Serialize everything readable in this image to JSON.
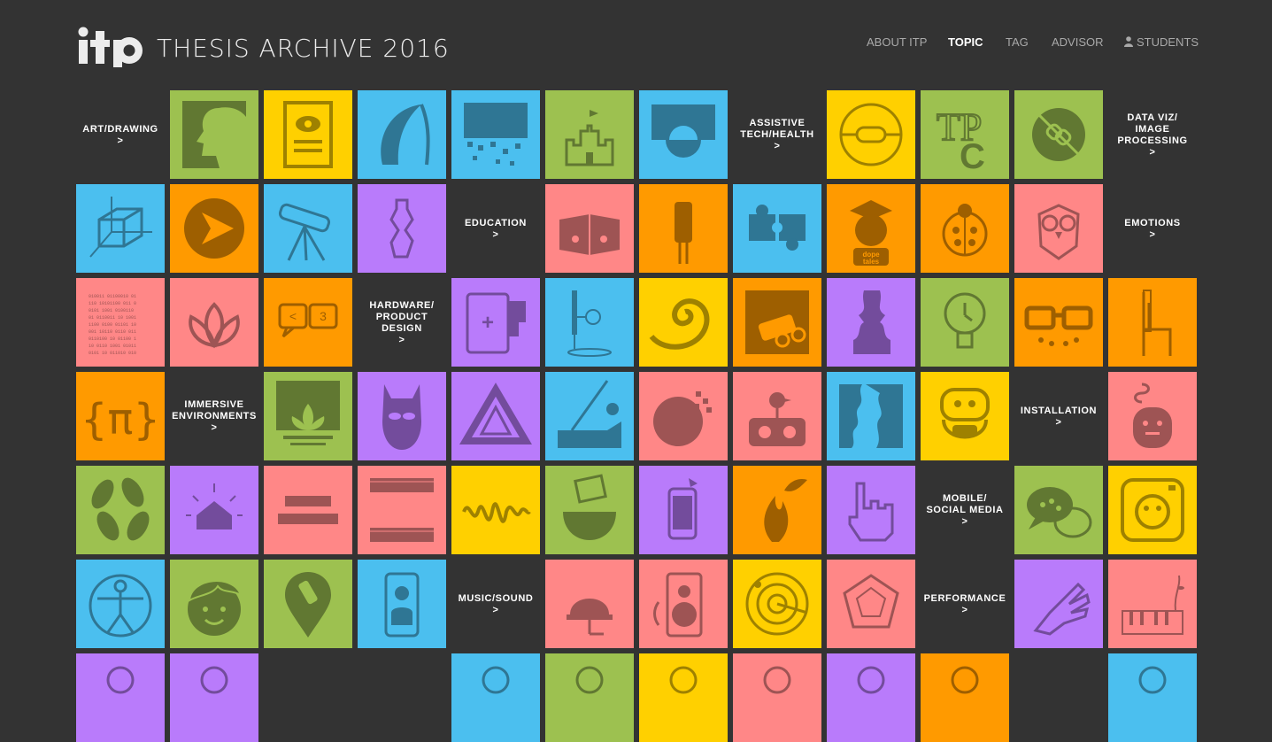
{
  "header": {
    "logo": "itp",
    "site_title": "THESIS ARCHIVE 2016"
  },
  "nav": {
    "items": [
      "ABOUT ITP",
      "TOPIC",
      "TAG",
      "ADVISOR",
      "STUDENTS"
    ],
    "active": "TOPIC",
    "students_icon": "person-icon"
  },
  "colors": {
    "background": "#333333",
    "green": "#9dc150",
    "yellow": "#ffd000",
    "blue": "#4bbfef",
    "orange": "#ff9a00",
    "pink": "#ff8787",
    "purple": "#b97bfb"
  },
  "topics": {
    "art_drawing": "ART/DRAWING",
    "assistive": "ASSISTIVE\nTECH/HEALTH",
    "data_viz": "DATA VIZ/\nIMAGE\nPROCESSING",
    "education": "EDUCATION",
    "emotions": "EMOTIONS",
    "hardware": "HARDWARE/\nPRODUCT\nDESIGN",
    "immersive": "IMMERSIVE\nENVIRONMENTS",
    "installation": "INSTALLATION",
    "mobile": "MOBILE/\nSOCIAL MEDIA",
    "music": "MUSIC/SOUND",
    "performance": "PERFORMANCE",
    "arrow": ">"
  },
  "tile_text": {
    "dope_tales": "dope\ntales",
    "heart_emoticon": "<3"
  },
  "rows": [
    [
      "label:art_drawing",
      "green:portrait-icon",
      "yellow:eye-document-icon",
      "blue:hair-strand-icon",
      "blue:pixel-waterfall-icon",
      "green:sandcastle-icon",
      "blue:circle-under-square-icon",
      "label:assistive",
      "yellow:hearing-aid-icon",
      "green:tpc-letters-icon",
      "green:broken-chain-icon",
      "label:data_viz"
    ],
    [
      "blue:3d-cube-icon",
      "orange:play-triangle-icon",
      "blue:telescope-icon",
      "purple:crumpled-bottle-icon",
      "label:education",
      "pink:open-book-icon",
      "orange:cable-plug-icon",
      "blue:puzzle-pieces-icon",
      "orange:graduate-girl-icon",
      "orange:ladybug-icon",
      "pink:owl-icon",
      "label:emotions"
    ],
    [
      "pink:binary-code-icon",
      "pink:lotus-flower-icon",
      "orange:speech-bubbles-icon",
      "label:hardware",
      "purple:battery-charger-icon",
      "blue:microphone-stand-icon",
      "yellow:nautilus-shell-icon",
      "orange:toy-car-icon",
      "purple:face-profiles-icon",
      "green:lightbulb-icon",
      "orange:glasses-monster-icon",
      "orange:chair-icon"
    ],
    [
      "orange:pi-braces-icon",
      "label:immersive",
      "green:lotus-screen-icon",
      "purple:superhero-mask-icon",
      "purple:impossible-triangle-icon",
      "blue:piano-lid-icon",
      "pink:pixel-planet-icon",
      "pink:vr-headset-bird-icon",
      "blue:map-silhouette-icon",
      "yellow:helmet-face-icon",
      "label:installation",
      "pink:robot-phone-icon"
    ],
    [
      "green:leaves-icon",
      "purple:glowing-house-icon",
      "pink:stacked-bars-icon",
      "pink:scribble-bars-icon",
      "yellow:soundwave-icon",
      "green:bowl-picture-icon",
      "purple:smartphone-bird-icon",
      "orange:flame-leaves-icon",
      "purple:pixel-hand-icon",
      "label:mobile",
      "green:chat-bubbles-icon",
      "yellow:camera-face-icon"
    ],
    [
      "blue:vitruvian-man-icon",
      "green:smiling-boy-icon",
      "green:map-pin-bottle-icon",
      "blue:phone-person-icon",
      "label:music",
      "pink:alarm-bell-icon",
      "pink:speaker-icon",
      "yellow:radar-target-icon",
      "pink:dodecahedron-icon",
      "label:performance",
      "purple:glove-icon",
      "pink:piano-sprouts-icon"
    ],
    [
      "purple:bottom-tile-icon",
      "purple:bottom-tile-icon",
      "empty",
      "empty",
      "blue:bottom-tile-icon",
      "green:bottom-tile-icon",
      "yellow:bottom-tile-icon",
      "pink:bottom-tile-icon",
      "purple:bottom-tile-icon",
      "orange:bottom-tile-icon",
      "empty",
      "blue:bottom-tile-icon"
    ]
  ]
}
